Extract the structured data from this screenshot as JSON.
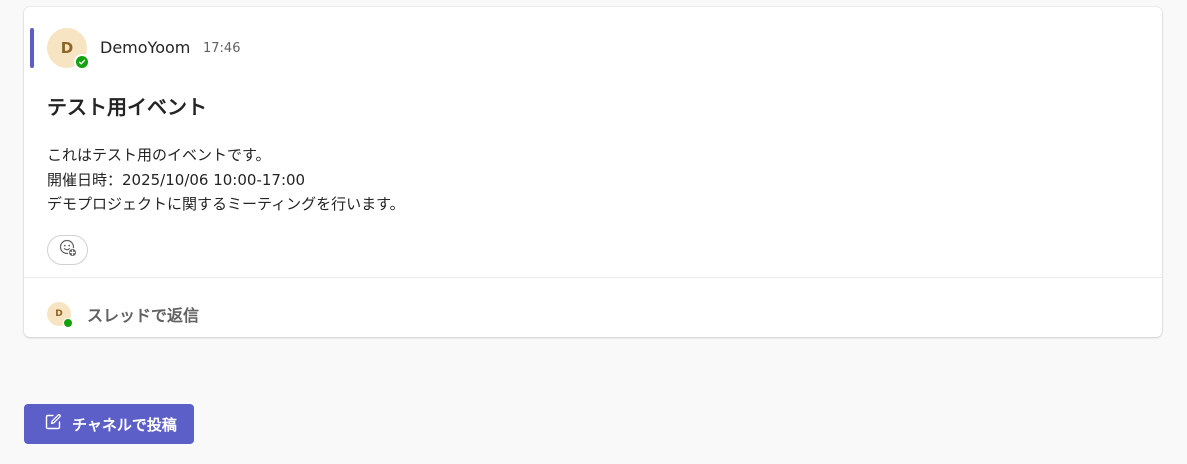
{
  "message": {
    "author_initial": "D",
    "author_name": "DemoYoom",
    "timestamp": "17:46",
    "subject": "テスト用イベント",
    "body_lines": [
      "これはテスト用のイベントです。",
      "開催日時：2025/10/06 10:00-17:00",
      "デモプロジェクトに関するミーティングを行います。"
    ],
    "presence_status": "available",
    "reaction_icon": "add-reaction-icon"
  },
  "reply": {
    "avatar_initial": "D",
    "label": "スレッドで返信"
  },
  "post_button": {
    "label": "チャネルで投稿",
    "icon": "compose-icon"
  },
  "colors": {
    "accent": "#5b5fc7",
    "presence_available": "#13a10e",
    "avatar_bg": "#f7e4c2",
    "avatar_text": "#8f6424"
  }
}
